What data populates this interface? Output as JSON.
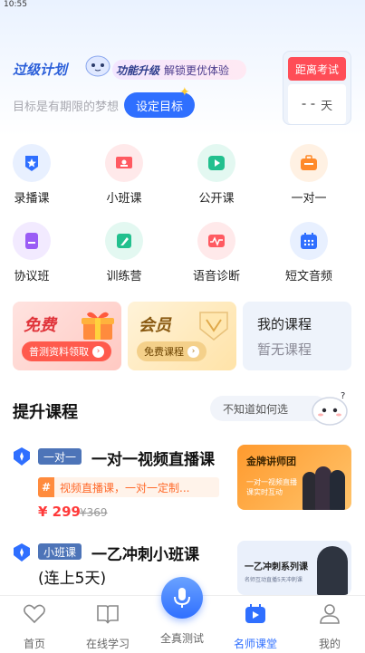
{
  "status": {
    "time": "10:55"
  },
  "hero": {
    "title": "过级计划",
    "upgrade_strong": "功能升级",
    "upgrade_text": "解锁更优体验",
    "goal_text": "目标是有期限的梦想",
    "goal_button": "设定目标",
    "exam_label": "距离考试",
    "exam_value": "- -",
    "exam_unit": "天"
  },
  "categories": [
    {
      "label": "录播课",
      "icon": "star-badge-icon",
      "bg": "#e8f0ff",
      "fg": "#2f6fff"
    },
    {
      "label": "小班课",
      "icon": "class-board-icon",
      "bg": "#ffe9ea",
      "fg": "#ff5a61"
    },
    {
      "label": "公开课",
      "icon": "play-icon",
      "bg": "#e3f8f1",
      "fg": "#22c08e"
    },
    {
      "label": "一对一",
      "icon": "briefcase-icon",
      "bg": "#fff1e3",
      "fg": "#ff8a2a"
    },
    {
      "label": "协议班",
      "icon": "document-icon",
      "bg": "#f2eaff",
      "fg": "#9a5cf5"
    },
    {
      "label": "训练营",
      "icon": "edit-icon",
      "bg": "#e3f8f1",
      "fg": "#22c08e"
    },
    {
      "label": "语音诊断",
      "icon": "waveform-icon",
      "bg": "#ffe9ea",
      "fg": "#ff5a61"
    },
    {
      "label": "短文音频",
      "icon": "calendar-icon",
      "bg": "#e8f0ff",
      "fg": "#2f6fff"
    }
  ],
  "promos": {
    "free": {
      "title": "免费",
      "pill": "普测资料领取"
    },
    "vip": {
      "title": "会员",
      "pill": "免费课程"
    },
    "my_course": {
      "title": "我的课程",
      "subtitle": "暂无课程"
    }
  },
  "section": {
    "title": "提升课程",
    "help": "不知道如何选"
  },
  "courses": [
    {
      "tag": "一对一",
      "title": "一对一视频直播课",
      "subline": "视频直播课，一对一定制...",
      "price": "¥ 299",
      "old_price": "¥369",
      "thumb_title": "金牌讲师团",
      "thumb_sub": "一对一视频直播 课实时互动"
    },
    {
      "tag": "小班课",
      "title_line1": "一乙冲刺小班课",
      "title_line2": "(连上5天)",
      "thumb_title": "一乙冲刺系列课",
      "thumb_sub": "名师互动直播5天冲刺课"
    }
  ],
  "nav": [
    {
      "label": "首页",
      "icon": "heart-icon"
    },
    {
      "label": "在线学习",
      "icon": "book-icon"
    },
    {
      "label": "全真测试",
      "icon": "microphone-icon"
    },
    {
      "label": "名师课堂",
      "icon": "video-icon",
      "active": true
    },
    {
      "label": "我的",
      "icon": "person-icon"
    }
  ],
  "colors": {
    "accent": "#2f6fff",
    "price": "#ff3a3a",
    "exam_header": "#ff4d57"
  }
}
